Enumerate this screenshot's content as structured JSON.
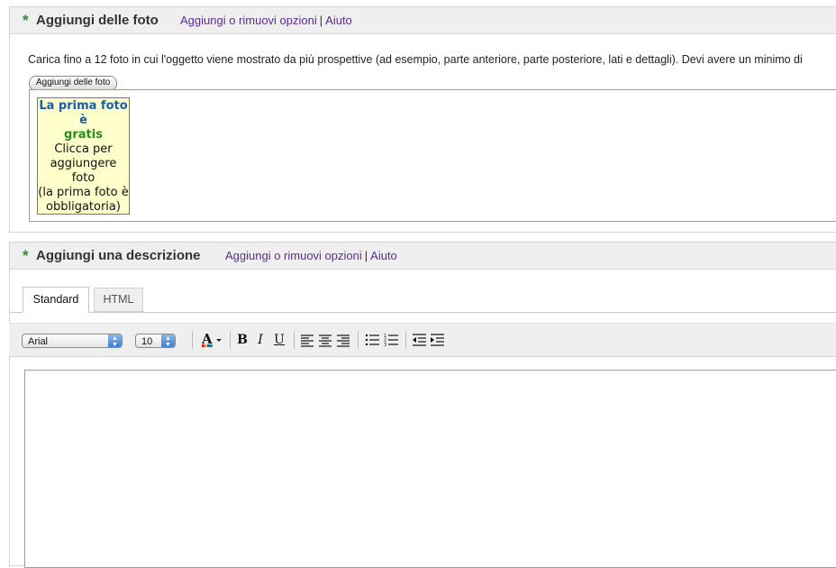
{
  "photos_section": {
    "star": "*",
    "title": "Aggiungi delle foto",
    "options_link": "Aggiungi o rimuovi opzioni",
    "separator": "|",
    "help_link": "Aiuto",
    "intro_text": "Carica fino a 12 foto in cui l'oggetto viene mostrato da più prospettive (ad esempio, parte anteriore, parte posteriore, lati e dettagli).  Devi avere un minimo di",
    "add_button_label": "Aggiungi delle foto",
    "slot": {
      "line1": "La prima foto",
      "line2": "è",
      "line3": "gratis",
      "line4": "Clicca per aggiungere foto",
      "line5": "(la prima foto è obbligatoria)"
    }
  },
  "description_section": {
    "star": "*",
    "title": "Aggiungi una descrizione",
    "options_link": "Aggiungi o rimuovi opzioni",
    "separator": "|",
    "help_link": "Aiuto",
    "tabs": [
      {
        "label": "Standard",
        "active": true
      },
      {
        "label": "HTML",
        "active": false
      }
    ],
    "toolbar": {
      "font_value": "Arial",
      "size_value": "10",
      "bold_label": "B",
      "italic_label": "I",
      "underline_label": "U"
    },
    "editor_content": ""
  },
  "colors": {
    "link": "#5a2e91",
    "required_star": "#2e8b2e",
    "slot_background": "#ffffcc",
    "slot_blue": "#1b5ea8",
    "slot_green": "#2a8a1a",
    "header_background": "#efefef"
  },
  "icons": [
    "font-color-icon",
    "align-left-icon",
    "align-center-icon",
    "align-right-icon",
    "bulleted-list-icon",
    "numbered-list-icon",
    "outdent-icon",
    "indent-icon"
  ]
}
